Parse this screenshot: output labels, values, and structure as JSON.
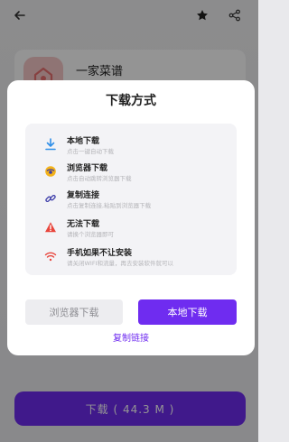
{
  "background": {
    "app_name": "一家菜谱",
    "download_button_label": "下载 ( 44.3 M )",
    "icons": {
      "back": "arrow-left-icon",
      "favorite": "star-icon",
      "share": "share-icon"
    }
  },
  "dialog": {
    "title": "下载方式",
    "options": [
      {
        "icon": "download-arrow-icon",
        "title": "本地下载",
        "desc": "点击一键自动下载"
      },
      {
        "icon": "browser-icon",
        "title": "浏览器下载",
        "desc": "点击自动跳转浏览器下载"
      },
      {
        "icon": "link-icon",
        "title": "复制连接",
        "desc": "点击复制连接,粘贴到浏览器下载"
      },
      {
        "icon": "warning-icon",
        "title": "无法下载",
        "desc": "请换个浏览器即可"
      },
      {
        "icon": "wifi-icon",
        "title": "手机如果不让安装",
        "desc": "请关闭WIFI和流量，再去安装软件就可以"
      }
    ],
    "browser_button": "浏览器下载",
    "local_button": "本地下载",
    "copy_link": "复制链接"
  },
  "colors": {
    "accent": "#6f2cf0",
    "download_icon": "#2f8fe8",
    "warning_icon": "#e8453c",
    "wifi_icon": "#e8453c",
    "browser_icon": "#f3b21b",
    "link_icon": "#3a3aa8"
  }
}
